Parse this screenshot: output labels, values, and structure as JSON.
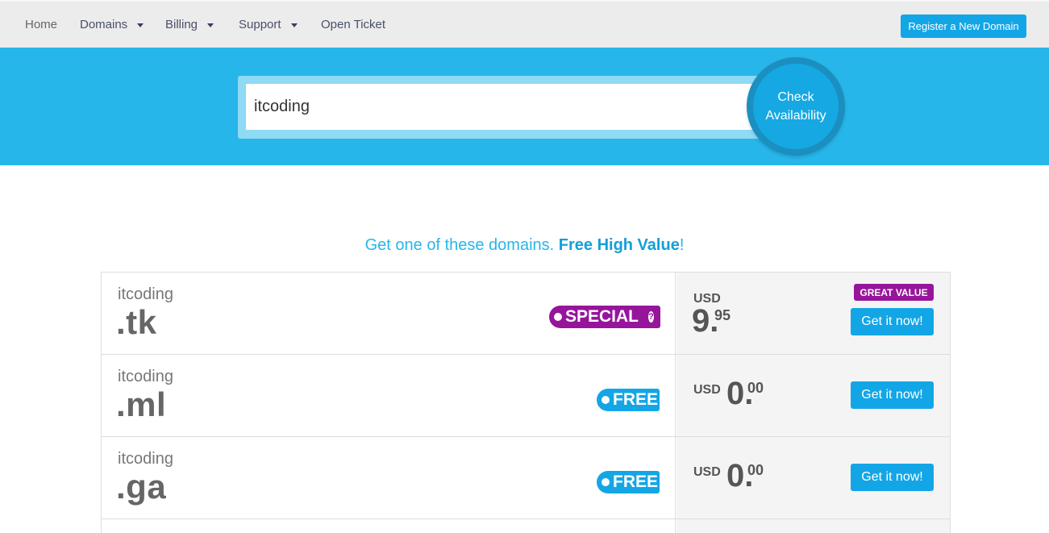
{
  "nav": {
    "home": "Home",
    "domains": "Domains",
    "billing": "Billing",
    "support": "Support",
    "open_ticket": "Open Ticket",
    "register_button": "Register a New Domain"
  },
  "search": {
    "value": "itcoding",
    "check_line1": "Check",
    "check_line2": "Availability"
  },
  "promo": {
    "prefix": "Get one of these domains. ",
    "highlight": "Free High Value",
    "suffix": "!"
  },
  "domains": [
    {
      "name": "itcoding",
      "tld": ".tk",
      "badge": "SPECIAL",
      "currency": "USD",
      "price_int": "9.",
      "price_dec": "95",
      "tag": "GREAT VALUE",
      "button": "Get it now!"
    },
    {
      "name": "itcoding",
      "tld": ".ml",
      "badge": "FREE",
      "currency": "USD",
      "price_int": "0.",
      "price_dec": "00",
      "button": "Get it now!"
    },
    {
      "name": "itcoding",
      "tld": ".ga",
      "badge": "FREE",
      "currency": "USD",
      "price_int": "0.",
      "price_dec": "00",
      "button": "Get it now!"
    }
  ],
  "colors": {
    "brand_blue": "#27b6ea",
    "button_blue": "#13a6e6",
    "special_purple": "#96159b"
  },
  "icons": {
    "dropdown": "chevron-down-icon",
    "help": "question-circle-icon",
    "bullet": "dot-icon"
  }
}
